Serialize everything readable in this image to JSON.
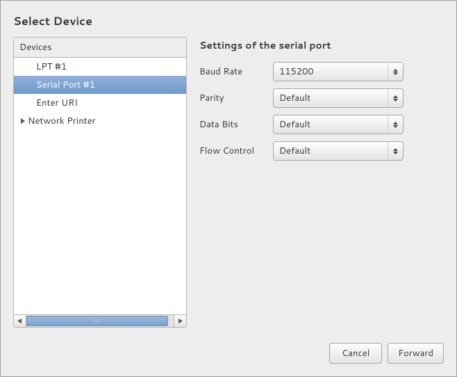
{
  "title": "Select Device",
  "sidebar": {
    "header": "Devices",
    "items": [
      {
        "label": "LPT #1",
        "expandable": false,
        "selected": false,
        "indent": 1
      },
      {
        "label": "Serial Port #1",
        "expandable": false,
        "selected": true,
        "indent": 1
      },
      {
        "label": "Enter URI",
        "expandable": false,
        "selected": false,
        "indent": 1
      },
      {
        "label": "Network Printer",
        "expandable": true,
        "selected": false,
        "indent": 0
      }
    ]
  },
  "settings": {
    "title": "Settings of the serial port",
    "fields": [
      {
        "label": "Baud Rate",
        "value": "115200"
      },
      {
        "label": "Parity",
        "value": "Default"
      },
      {
        "label": "Data Bits",
        "value": "Default"
      },
      {
        "label": "Flow Control",
        "value": "Default"
      }
    ]
  },
  "buttons": {
    "cancel": "Cancel",
    "forward": "Forward"
  }
}
